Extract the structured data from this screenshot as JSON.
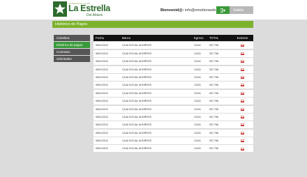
{
  "brand": {
    "small_text": "FUNDACION CLUB",
    "name": "La Estrella",
    "subtitle": "Del Abisrá"
  },
  "user": {
    "greeting": "Bienvenid@:",
    "email": "info@emotionweb.com"
  },
  "logout": {
    "label": "Salida",
    "icon": "exit-icon"
  },
  "page_title": "Histórico de Pagos",
  "sidebar": {
    "items": [
      {
        "label": "Cartelera",
        "active": false
      },
      {
        "label": "Histórico de pagos",
        "active": true
      },
      {
        "label": "Contratos",
        "active": false
      },
      {
        "label": "Solicitudes",
        "active": false
      }
    ]
  },
  "table": {
    "headers": {
      "fecha": "Fecha",
      "banco": "Banco",
      "egreso": "Egreso",
      "total": "TOTAL",
      "extracto": "Extracto"
    },
    "rows": [
      {
        "fecha": "08/01/2012",
        "banco": "CAJA SOCIAL AHORROS",
        "egreso": "12441",
        "total": "537,756",
        "extracto_icon": "pdf-icon"
      },
      {
        "fecha": "08/01/2012",
        "banco": "CAJA SOCIAL AHORROS",
        "egreso": "12441",
        "total": "537,756",
        "extracto_icon": "pdf-icon"
      },
      {
        "fecha": "08/01/2012",
        "banco": "CAJA SOCIAL AHORROS",
        "egreso": "12441",
        "total": "537,756",
        "extracto_icon": "pdf-icon"
      },
      {
        "fecha": "08/01/2012",
        "banco": "CAJA SOCIAL AHORROS",
        "egreso": "12441",
        "total": "537,756",
        "extracto_icon": "pdf-icon"
      },
      {
        "fecha": "08/01/2012",
        "banco": "CAJA SOCIAL AHORROS",
        "egreso": "12441",
        "total": "537,756",
        "extracto_icon": "pdf-icon"
      },
      {
        "fecha": "08/01/2012",
        "banco": "CAJA SOCIAL AHORROS",
        "egreso": "12441",
        "total": "537,756",
        "extracto_icon": "pdf-icon"
      },
      {
        "fecha": "08/01/2012",
        "banco": "CAJA SOCIAL AHORROS",
        "egreso": "12441",
        "total": "537,756",
        "extracto_icon": "pdf-icon"
      },
      {
        "fecha": "08/01/2012",
        "banco": "CAJA SOCIAL AHORROS",
        "egreso": "12441",
        "total": "537,756",
        "extracto_icon": "pdf-icon"
      },
      {
        "fecha": "08/01/2012",
        "banco": "CAJA SOCIAL AHORROS",
        "egreso": "12441",
        "total": "537,756",
        "extracto_icon": "pdf-icon"
      },
      {
        "fecha": "08/01/2012",
        "banco": "CAJA SOCIAL AHORROS",
        "egreso": "12441",
        "total": "537,756",
        "extracto_icon": "pdf-icon"
      },
      {
        "fecha": "08/01/2012",
        "banco": "CAJA SOCIAL AHORROS",
        "egreso": "12441",
        "total": "537,756",
        "extracto_icon": "pdf-icon"
      },
      {
        "fecha": "08/01/2012",
        "banco": "CAJA SOCIAL AHORROS",
        "egreso": "12441",
        "total": "537,756",
        "extracto_icon": "pdf-icon"
      },
      {
        "fecha": "08/01/2012",
        "banco": "CAJA SOCIAL AHORROS",
        "egreso": "12441",
        "total": "537,756",
        "extracto_icon": "pdf-icon"
      },
      {
        "fecha": "08/01/2012",
        "banco": "CAJA SOCIAL AHORROS",
        "egreso": "12441",
        "total": "537,756",
        "extracto_icon": "pdf-icon"
      }
    ]
  },
  "colors": {
    "accent_green": "#7db32c",
    "brand_green": "#2e6b2e",
    "active_green": "#3a9a3a",
    "sidebar_gray": "#555555",
    "table_header": "#111111",
    "pdf_red": "#cc2222"
  }
}
